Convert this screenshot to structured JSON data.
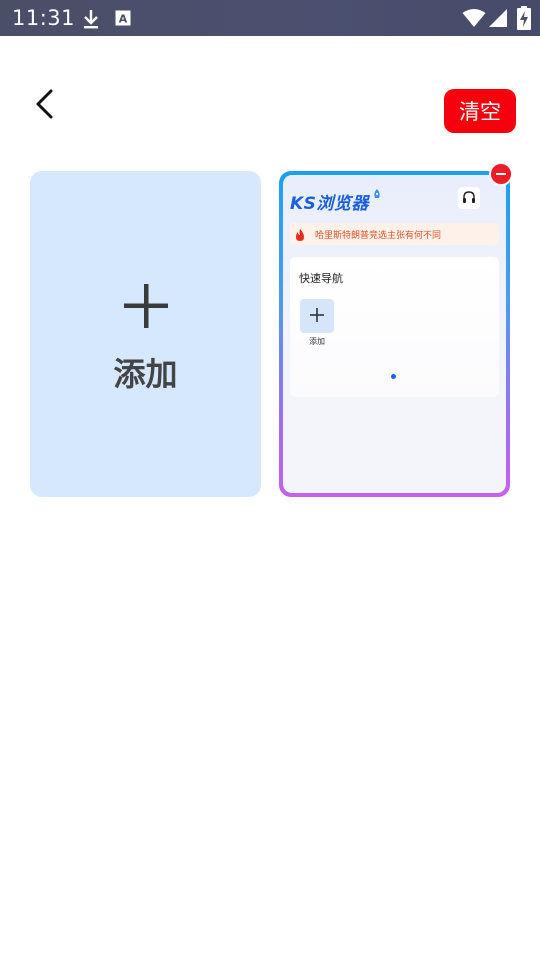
{
  "status_bar": {
    "time": "11:31",
    "icons": [
      "download-icon",
      "text-a-icon",
      "wifi-icon",
      "signal-icon",
      "battery-charging-icon"
    ]
  },
  "toolbar": {
    "back_icon": "chevron-left-icon",
    "clear_label": "清空",
    "clear_color": "#f5000c"
  },
  "add_card": {
    "label": "添加",
    "icon": "plus-icon",
    "background": "#d6e8fd"
  },
  "tabs": [
    {
      "close_icon": "minus-circle-icon",
      "preview": {
        "logo_text": "KS浏览器",
        "headset_icon": "headset-icon",
        "news_text": "哈里斯特朗普竞选主张有何不同",
        "nav_title": "快速导航",
        "nav_add_label": "添加"
      }
    }
  ]
}
